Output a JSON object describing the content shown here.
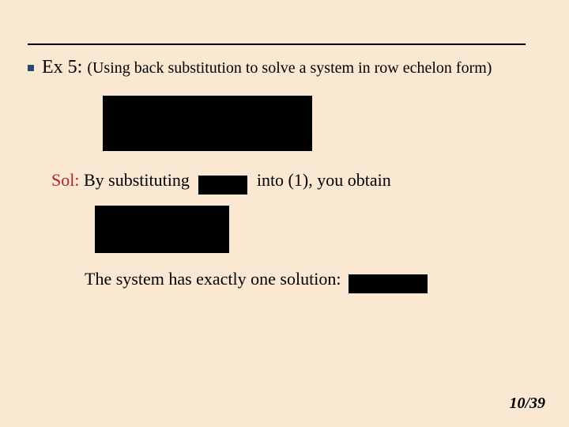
{
  "header": {
    "ex_label": "Ex 5:",
    "ex_subtitle": "(Using back substitution to solve a system in row echelon form)"
  },
  "solution": {
    "sol_label": "Sol:",
    "line1_before": "By substituting",
    "line1_after": "into (1), you obtain",
    "final_text": "The system has exactly one solution:"
  },
  "footer": {
    "page": "10/39"
  }
}
